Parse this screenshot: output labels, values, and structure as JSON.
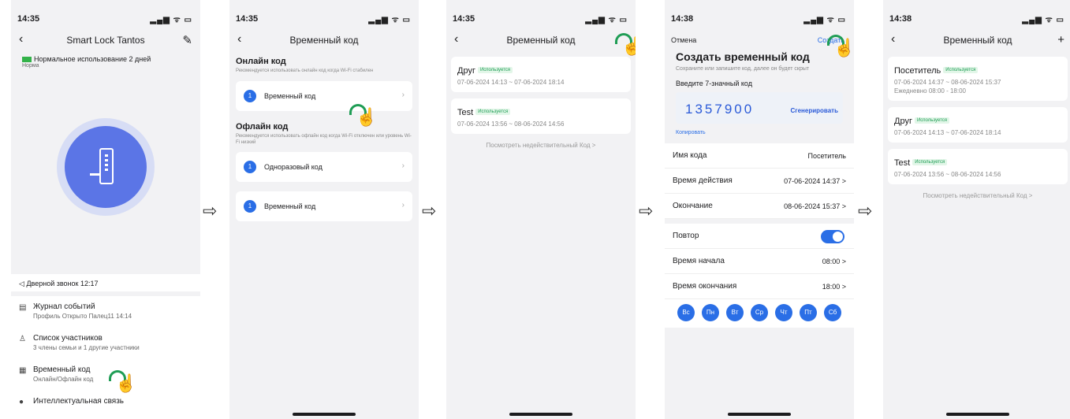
{
  "panel1": {
    "time": "14:35",
    "title": "Smart Lock Tantos",
    "battery_text": "Нормальное использование 2 дней",
    "battery_sub": "Норма",
    "doorbell": "Дверной звонок 12:17",
    "menu": [
      {
        "title": "Журнал событий",
        "sub": "Профиль Открыто Палец11 14:14"
      },
      {
        "title": "Список участников",
        "sub": "3 члены семьи и 1 другие участники"
      },
      {
        "title": "Временный код",
        "sub": "Онлайн/Офлайн код"
      },
      {
        "title": "Интеллектуальная связь",
        "sub": ""
      }
    ]
  },
  "panel2": {
    "time": "14:35",
    "title": "Временный код",
    "online_title": "Онлайн код",
    "online_desc": "Рекомендуется использовать онлайн код когда Wi-Fi стабилен",
    "online_item": "Временный код",
    "offline_title": "Офлайн код",
    "offline_desc": "Рекомендуется использовать офлайн код когда Wi-Fi отключен или уровень Wi-Fi низкий",
    "offline_items": [
      "Одноразовый код",
      "Временный код"
    ],
    "nums": [
      "1",
      "1",
      "1"
    ]
  },
  "panel3": {
    "time": "14:35",
    "title": "Временный код",
    "cards": [
      {
        "name": "Друг",
        "badge": "Используется",
        "time": "07-06-2024 14:13 ~ 07-06-2024 18:14"
      },
      {
        "name": "Test",
        "badge": "Используется",
        "time": "07-06-2024 13:56 ~ 08-06-2024 14:56"
      }
    ],
    "invalid": "Посмотреть недействительный Код >"
  },
  "panel4": {
    "time": "14:38",
    "cancel": "Отмена",
    "create": "Создать",
    "heading": "Создать временный код",
    "desc": "Сохраните или запишите код, далее он будет скрыт",
    "input_label": "Введите 7-значный код",
    "code": "1357900",
    "generate": "Сгенерировать",
    "copy": "Копировать",
    "fields": [
      {
        "k": "Имя кода",
        "v": "Посетитель"
      },
      {
        "k": "Время действия",
        "v": "07-06-2024 14:37 >"
      },
      {
        "k": "Окончание",
        "v": "08-06-2024 15:37 >"
      }
    ],
    "repeat": "Повтор",
    "start": {
      "k": "Время начала",
      "v": "08:00 >"
    },
    "end": {
      "k": "Время окончания",
      "v": "18:00 >"
    },
    "days": [
      "Вс",
      "Пн",
      "Вт",
      "Ср",
      "Чт",
      "Пт",
      "Сб"
    ]
  },
  "panel5": {
    "time": "14:38",
    "title": "Временный код",
    "cards": [
      {
        "name": "Посетитель",
        "badge": "Используется",
        "time": "07-06-2024 14:37 ~ 08-06-2024 15:37",
        "extra": "Ежедневно 08:00 - 18:00"
      },
      {
        "name": "Друг",
        "badge": "Используется",
        "time": "07-06-2024 14:13 ~ 07-06-2024 18:14"
      },
      {
        "name": "Test",
        "badge": "Используется",
        "time": "07-06-2024 13:56 ~ 08-06-2024 14:56"
      }
    ],
    "invalid": "Посмотреть недействительный Код >"
  },
  "arrow_glyph": "⇨",
  "status_icons": "▂▄▆ ᯤ ▭"
}
